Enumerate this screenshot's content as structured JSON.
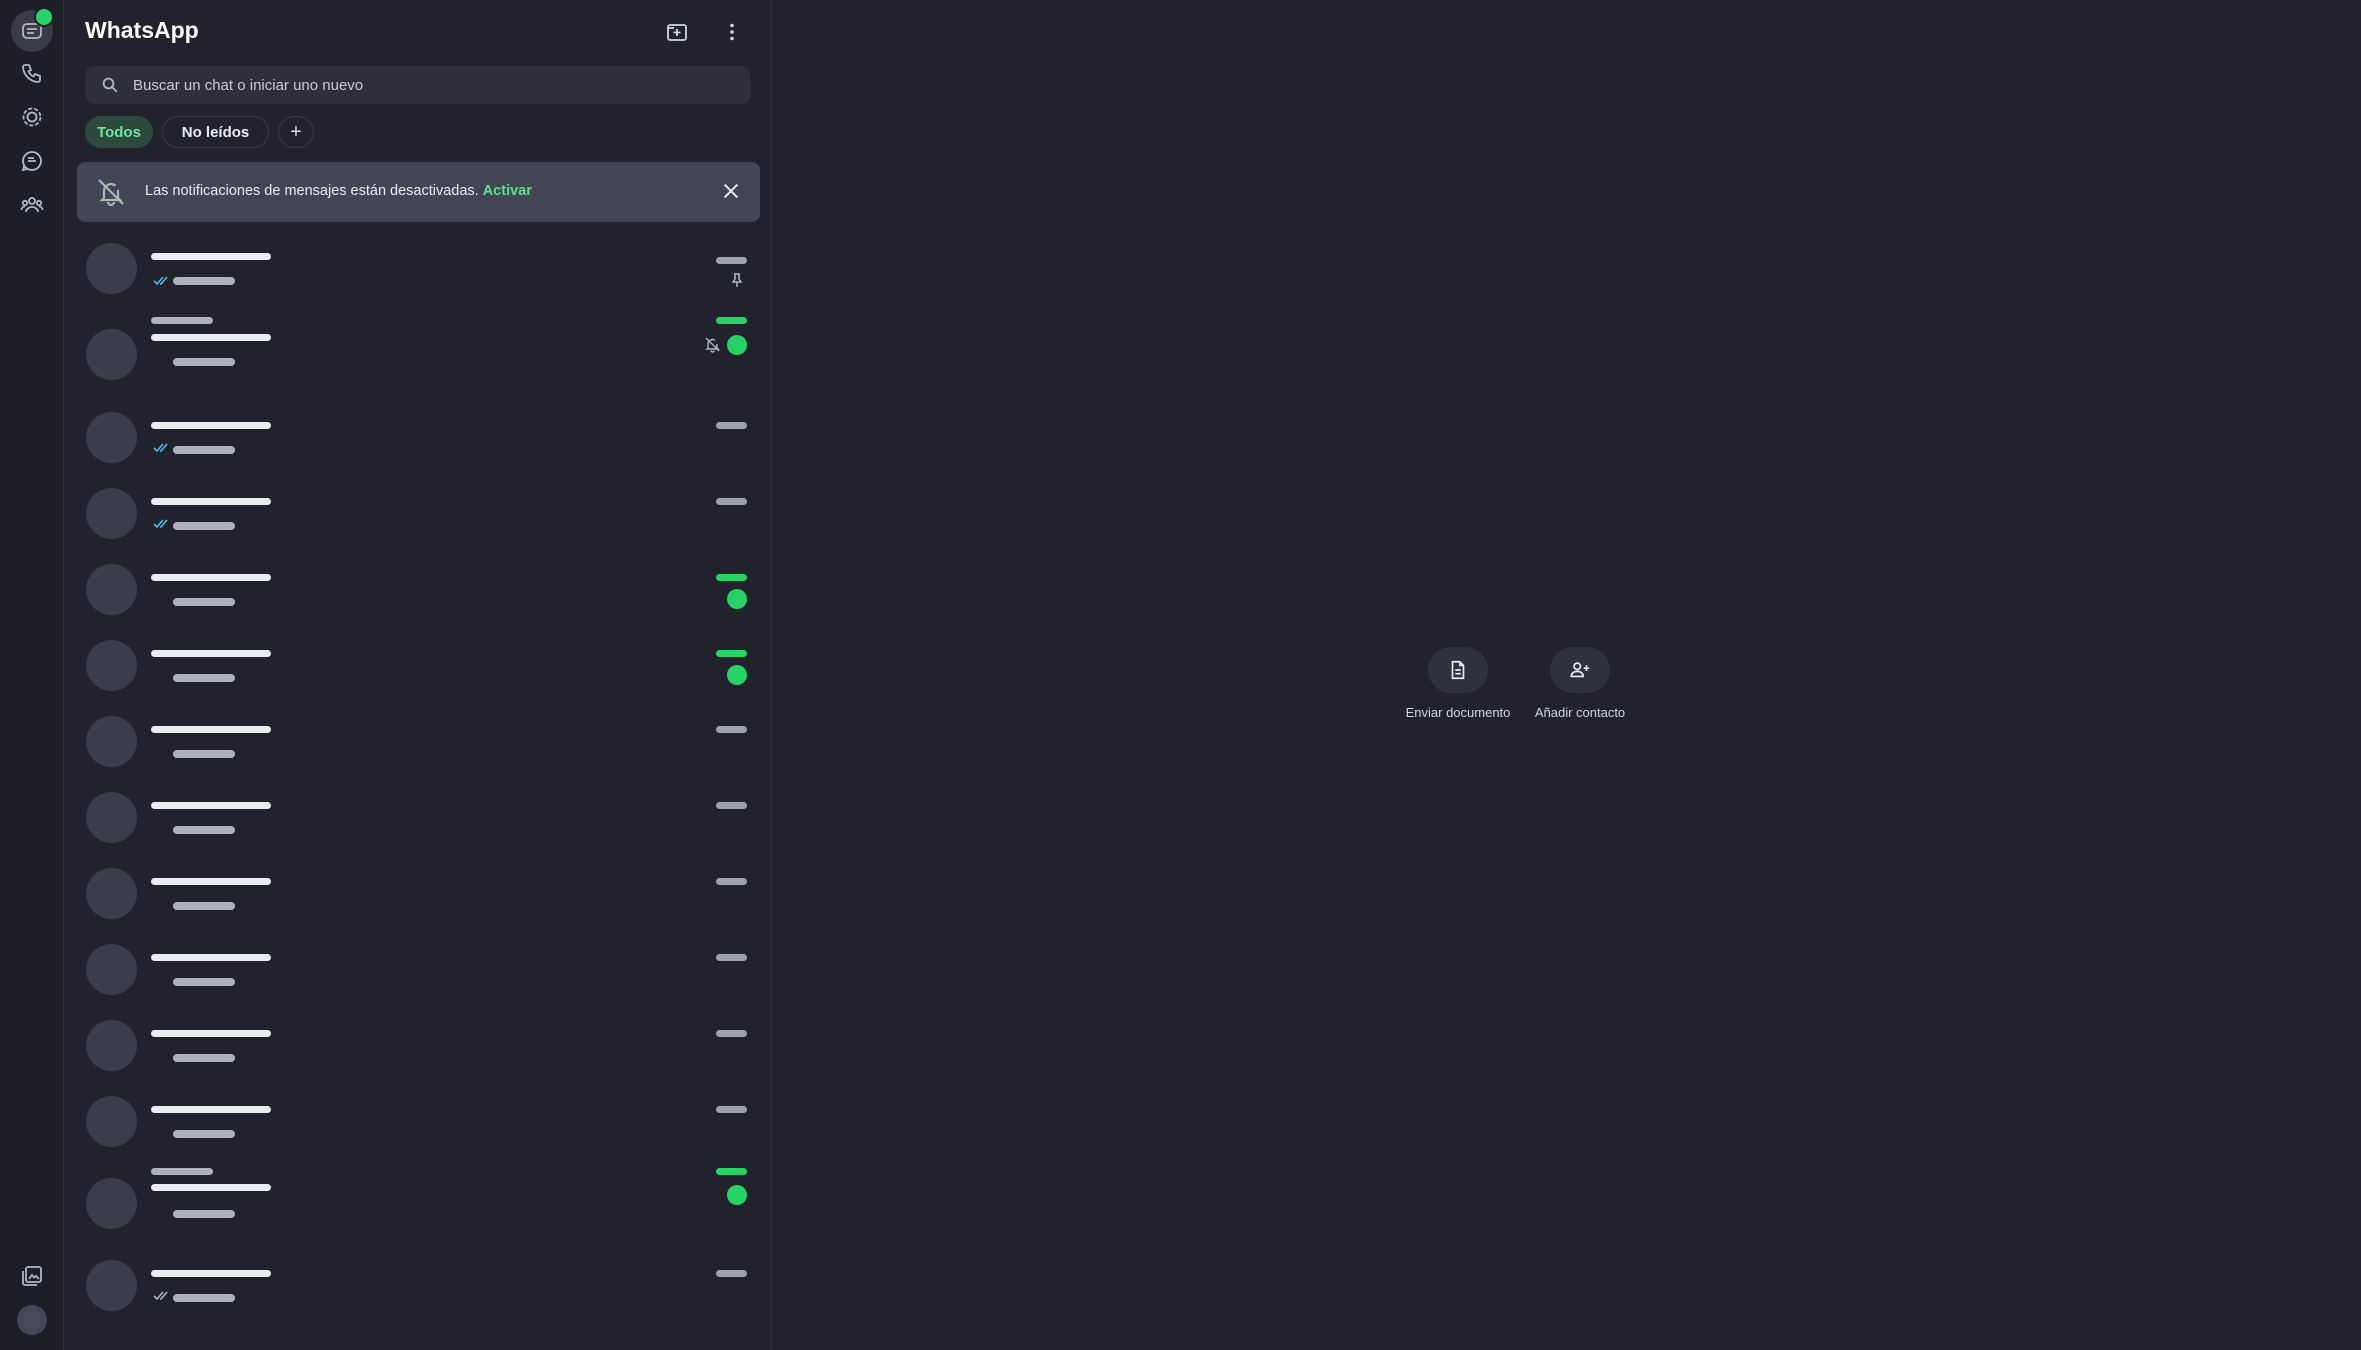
{
  "app": {
    "title": "WhatsApp"
  },
  "rail": {
    "items": [
      {
        "icon": "chats-icon",
        "label": "Chats",
        "active": true
      },
      {
        "icon": "calls-icon",
        "label": "Llamadas"
      },
      {
        "icon": "status-icon",
        "label": "Estados"
      },
      {
        "icon": "channels-icon",
        "label": "Canales"
      },
      {
        "icon": "communities-icon",
        "label": "Comunidades"
      },
      {
        "icon": "media-icon",
        "label": "Archivos multimedia"
      }
    ]
  },
  "search": {
    "placeholder": "Buscar un chat o iniciar uno nuevo"
  },
  "filters": {
    "all": "Todos",
    "unread": "No leídos",
    "add": "+"
  },
  "notice": {
    "text": "Las notificaciones de mensajes están desactivadas.",
    "link": "Activar"
  },
  "actions": {
    "send_document": "Enviar documento",
    "add_contact": "Añadir contacto"
  },
  "colors": {
    "accent": "#25d366",
    "background": "#21222b",
    "read_ticks": "#53bdeb"
  }
}
